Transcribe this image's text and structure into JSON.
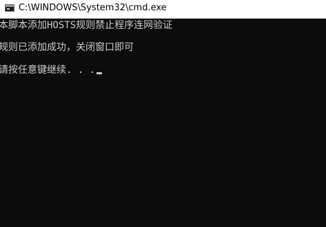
{
  "window": {
    "title": "C:\\WINDOWS\\System32\\cmd.exe",
    "icon": "cmd-icon"
  },
  "console": {
    "lines": [
      "本脚本添加HOSTS规则禁止程序连网验证",
      "规则已添加成功，关闭窗口即可",
      "请按任意键继续. . ."
    ],
    "text_color": "#cccccc",
    "background_color": "#0c0c0c"
  }
}
